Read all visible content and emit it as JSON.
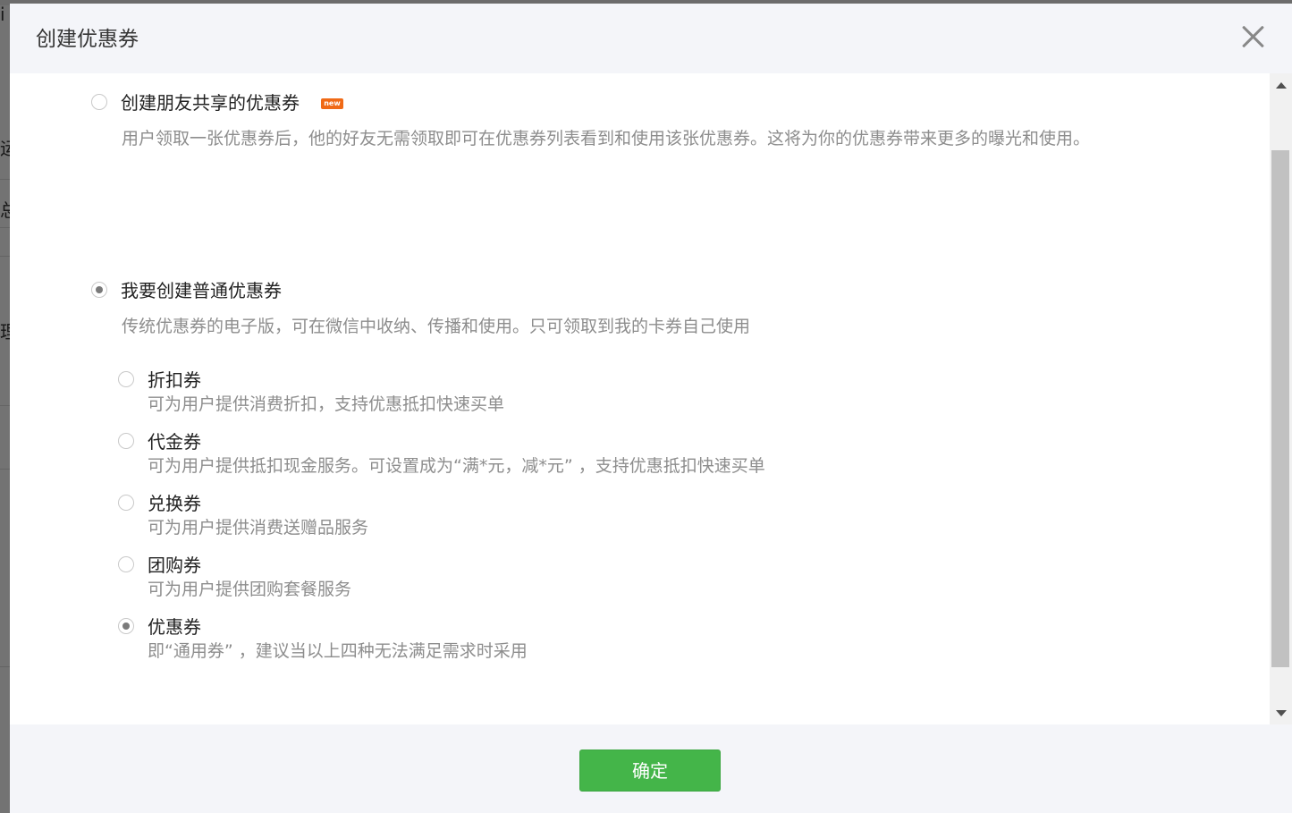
{
  "dialog": {
    "title": "创建优惠券",
    "close_icon": "close-icon",
    "footer": {
      "confirm_label": "确定"
    }
  },
  "options": {
    "friend_share": {
      "label": "创建朋友共享的优惠券",
      "badge": "new",
      "description": "用户领取一张优惠券后，他的好友无需领取即可在优惠券列表看到和使用该张优惠券。这将为你的优惠券带来更多的曝光和使用。",
      "checked": false
    },
    "normal": {
      "label": "我要创建普通优惠券",
      "description": "传统优惠券的电子版，可在微信中收纳、传播和使用。只可领取到我的卡券自己使用",
      "checked": true,
      "types": [
        {
          "label": "折扣券",
          "description": "可为用户提供消费折扣，支持优惠抵扣快速买单",
          "checked": false
        },
        {
          "label": "代金券",
          "description": "可为用户提供抵扣现金服务。可设置成为“满*元，减*元” ，支持优惠抵扣快速买单",
          "checked": false
        },
        {
          "label": "兑换券",
          "description": "可为用户提供消费送赠品服务",
          "checked": false
        },
        {
          "label": "团购券",
          "description": "可为用户提供团购套餐服务",
          "checked": false
        },
        {
          "label": "优惠券",
          "description": "即“通用券” ，建议当以上四种无法满足需求时采用",
          "checked": true
        }
      ]
    }
  },
  "background_fragments": [
    "i",
    "运",
    "总",
    "理"
  ],
  "colors": {
    "primary_button": "#44b549",
    "badge": "#f06a16",
    "header_bg": "#f4f5f9",
    "overlay": "#6f6f6f"
  }
}
